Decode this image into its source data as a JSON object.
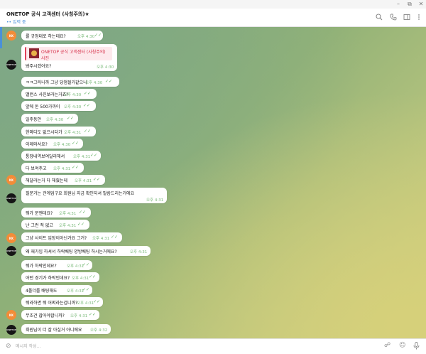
{
  "window": {
    "controls": [
      "–",
      "⧉",
      "✕"
    ]
  },
  "header": {
    "title": "ONETOP 공식 고객센터 (사칭주의)★",
    "status": "입력 중",
    "icons": [
      "search-icon",
      "phone-icon",
      "sidebar-toggle-icon",
      "more-icon"
    ]
  },
  "avatars": {
    "kk": "KK",
    "ot": "ONETOP"
  },
  "composer": {
    "placeholder": "메시지 작성..."
  },
  "messages": [
    {
      "sender": "kk",
      "text": "룰 규정대로 하는데요?",
      "time": "오후 4:30",
      "read": true
    },
    {
      "sender": "ot",
      "reply": {
        "name": "ONETOP 공식 고객센터 (사칭주의)",
        "preview": "사진"
      },
      "text": "봐주시겠어요?",
      "time": "오후 4:30",
      "read": false
    },
    {
      "sender": "kk",
      "text": "ㅋㅋ그러니까 그냥 당첨될거같으니",
      "time": "오후 4:30",
      "read": true
    },
    {
      "sender": "kk",
      "text": "밸런스 사진보라는거죠?",
      "time": "오후 4:30",
      "read": true
    },
    {
      "sender": "kk",
      "text": "앞에 돈 500가까이",
      "time": "오후 4:30",
      "read": true
    },
    {
      "sender": "kk",
      "text": "일주동안",
      "time": "오후 4:30",
      "read": true
    },
    {
      "sender": "kk",
      "text": "한마디도 없으시다가",
      "time": "오후 4:31",
      "read": true
    },
    {
      "sender": "kk",
      "text": "이제와서요?",
      "time": "오후 4:30",
      "read": true
    },
    {
      "sender": "kk",
      "text": "통장내역보여달라해서",
      "time": "오후 4:31",
      "read": true
    },
    {
      "sender": "kk",
      "text": "다 보여주고",
      "time": "오후 4:31",
      "read": true
    },
    {
      "sender": "kk",
      "text": "해달라는거 다 해줬는데",
      "time": "오후 4:31",
      "read": true
    },
    {
      "sender": "ot",
      "text": "질문거는 관계업구요 회원님 지금 확인되셔 말씀드리는거에요",
      "time": "오후 4:31",
      "read": false
    },
    {
      "sender": "kk",
      "text": "뭐가 문젠데요?",
      "time": "오후 4:31",
      "read": true
    },
    {
      "sender": "kk",
      "text": "난 그런 적 없고",
      "time": "오후 4:31",
      "read": true
    },
    {
      "sender": "kk",
      "text": "그냥 사이트 입장이아닌가요 그거?",
      "time": "오후 4:31",
      "read": true
    },
    {
      "sender": "ot",
      "text": "왜 재가입 하셔서 하락배팅 양방배팅 하시는거에요?",
      "time": "오후 4:31",
      "read": false
    },
    {
      "sender": "kk",
      "text": "뭐가 하락인데요?",
      "time": "오후 4:31",
      "read": true
    },
    {
      "sender": "kk",
      "text": "어떤 경기가 하락인데요?",
      "time": "오후 4:31",
      "read": true
    },
    {
      "sender": "kk",
      "text": "4폴더를 배팅해도",
      "time": "오후 4:31",
      "read": true
    },
    {
      "sender": "kk",
      "text": "뭐라하면 뭐 어쩌라는겁니까?",
      "time": "오후 4:31",
      "read": true
    },
    {
      "sender": "kk",
      "text": "무조건 잡아야합니까?",
      "time": "오후 4:31",
      "read": true
    },
    {
      "sender": "ot",
      "text": "회원님이 더 잘 아실거 아니에요",
      "time": "오후 4:32",
      "read": false
    }
  ]
}
